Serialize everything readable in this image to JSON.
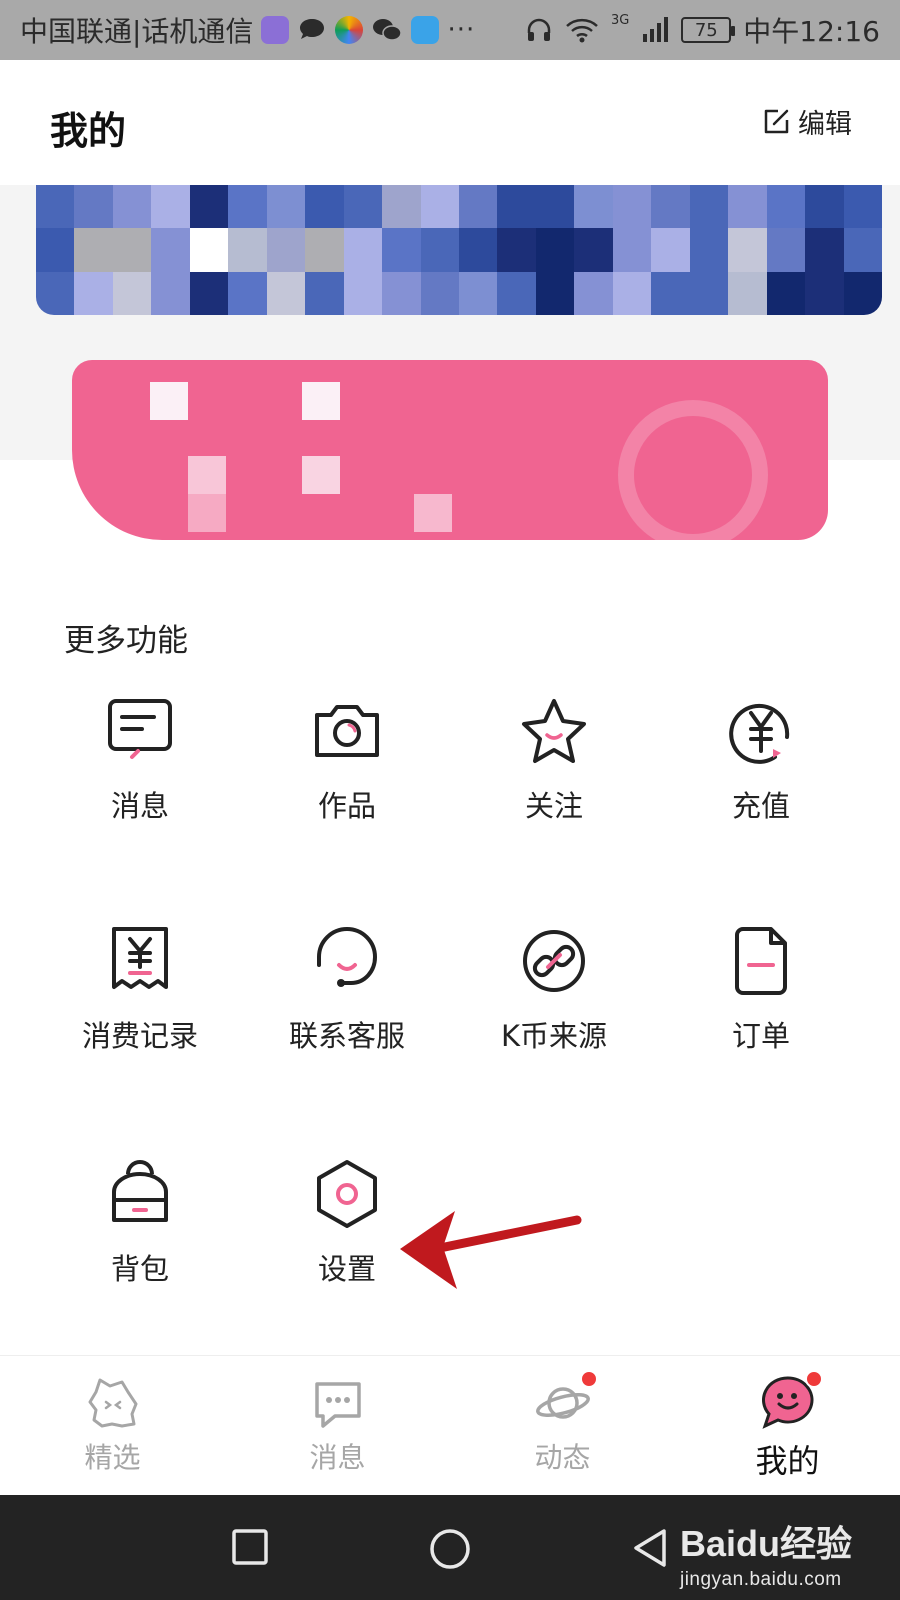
{
  "status_bar": {
    "carrier": "中国联通|话机通信",
    "network": "3G",
    "battery": "75",
    "time": "中午12:16",
    "icons": [
      "qq-app-icon",
      "message-bubble-icon",
      "colorful-app-icon",
      "wechat-icon",
      "shield-app-icon",
      "more-dots-icon",
      "headset-icon",
      "wifi-icon",
      "signal-icon",
      "battery-icon"
    ],
    "more": "···"
  },
  "header": {
    "title": "我的",
    "edit_label": "编辑"
  },
  "more_functions": {
    "title": "更多功能",
    "items": [
      {
        "label": "消息",
        "icon": "message-icon"
      },
      {
        "label": "作品",
        "icon": "camera-icon"
      },
      {
        "label": "关注",
        "icon": "star-icon"
      },
      {
        "label": "充值",
        "icon": "yen-coin-icon"
      },
      {
        "label": "消费记录",
        "icon": "receipt-icon"
      },
      {
        "label": "联系客服",
        "icon": "headset-icon"
      },
      {
        "label": "K币来源",
        "icon": "link-icon"
      },
      {
        "label": "订单",
        "icon": "document-icon"
      },
      {
        "label": "背包",
        "icon": "backpack-icon"
      },
      {
        "label": "设置",
        "icon": "hexagon-settings-icon"
      }
    ]
  },
  "bottom_nav": {
    "items": [
      {
        "label": "精选",
        "icon": "cat-face-icon",
        "active": false,
        "badge": false
      },
      {
        "label": "消息",
        "icon": "chat-bubble-icon",
        "active": false,
        "badge": false
      },
      {
        "label": "动态",
        "icon": "planet-icon",
        "active": false,
        "badge": true
      },
      {
        "label": "我的",
        "icon": "pink-smile-bubble-icon",
        "active": true,
        "badge": true
      }
    ]
  },
  "watermark": {
    "main": "Baidu经验",
    "sub": "jingyan.baidu.com"
  },
  "colors": {
    "accent_pink": "#f06491",
    "badge_red": "#ef3a3a",
    "annotation_red": "#c0191e",
    "status_bar_bg": "#a9a9a9",
    "system_nav_bg": "#232323"
  }
}
